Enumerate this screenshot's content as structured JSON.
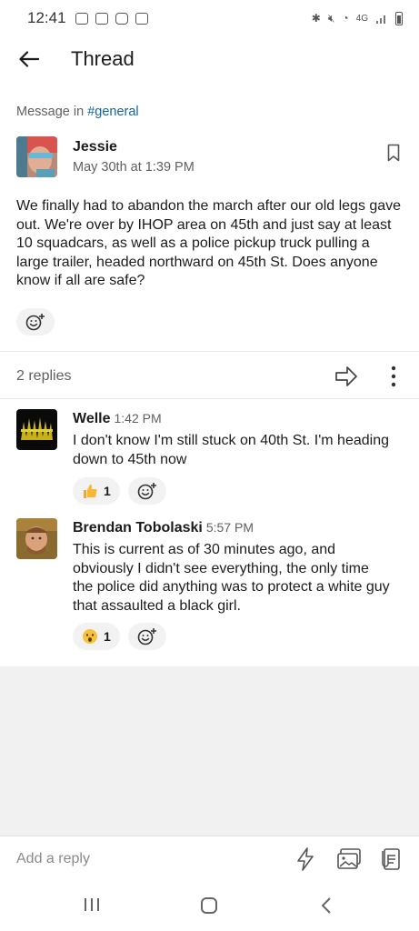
{
  "status": {
    "time": "12:41",
    "network": "4G"
  },
  "header": {
    "title": "Thread"
  },
  "context": {
    "prefix": "Message in ",
    "channel": "#general"
  },
  "parent": {
    "author": "Jessie",
    "date": "May 30th at 1:39 PM",
    "text": "We finally had to abandon the march after our old legs gave out. We're over by IHOP area on 45th and just say at least 10 squadcars, as well as a police pickup truck pulling a large trailer, headed northward on 45th St. Does anyone know if all are safe?"
  },
  "replies_bar": {
    "count": "2 replies"
  },
  "replies": [
    {
      "author": "Welle",
      "time": "1:42 PM",
      "text": "I don't know I'm still stuck on 40th St. I'm heading down to 45th now",
      "reaction": {
        "emoji": "thumbs-up",
        "count": "1"
      }
    },
    {
      "author": "Brendan Tobolaski",
      "time": "5:57 PM",
      "text": "This is current as of 30 minutes ago, and obviously I didn't see everything, the only time the police did anything was to protect a white guy that assaulted a black girl.",
      "reaction": {
        "emoji": "hushed-face",
        "count": "1"
      }
    }
  ],
  "composer": {
    "placeholder": "Add a reply"
  },
  "colors": {
    "link": "#1264a3",
    "secondary_text": "#616061",
    "primary_text": "#1d1c1d"
  }
}
